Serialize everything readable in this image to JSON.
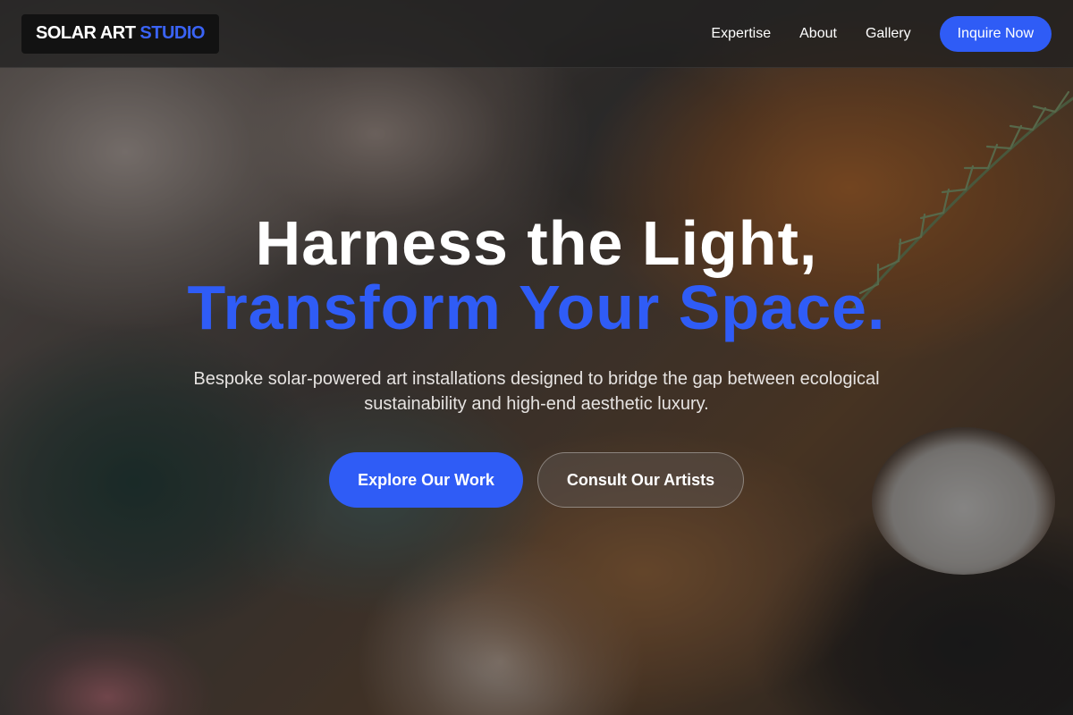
{
  "brand": {
    "name_main": "SOLAR ART",
    "name_accent": "STUDIO"
  },
  "nav": {
    "links": [
      "Expertise",
      "About",
      "Gallery"
    ],
    "cta_label": "Inquire Now"
  },
  "hero": {
    "headline_line1": "Harness the Light,",
    "headline_line2": "Transform Your Space.",
    "subtext": "Bespoke solar-powered art installations designed to bridge the gap between ecological sustainability and high-end aesthetic luxury.",
    "primary_cta": "Explore Our Work",
    "secondary_cta": "Consult Our Artists",
    "background_image": "abstract-oil-paint-palette"
  },
  "colors": {
    "accent": "#2f5cf6",
    "text": "#ffffff"
  }
}
